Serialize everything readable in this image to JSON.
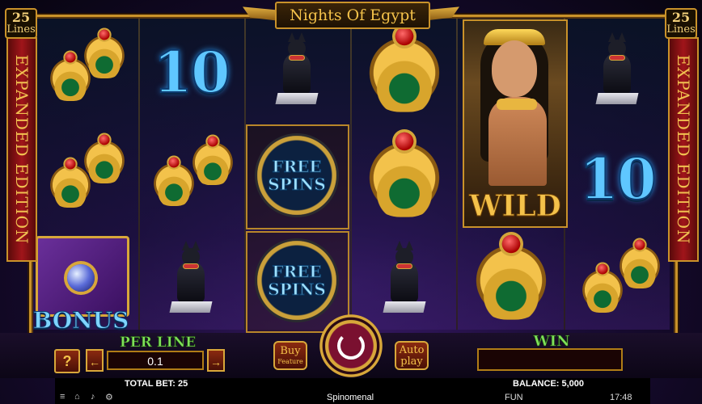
{
  "game": {
    "title": "Nights Of Egypt",
    "lines_badge": {
      "number": "25",
      "word": "Lines"
    },
    "edition_banner": "EXPANDED EDITION"
  },
  "reels": {
    "symbols": [
      [
        "scarab-pair",
        "scarab-pair",
        "bonus-book"
      ],
      [
        "ten",
        "scarab-pair",
        "cat"
      ],
      [
        "cat",
        "free-spins",
        "free-spins"
      ],
      [
        "scarab",
        "scarab",
        "cat"
      ],
      [
        "wild",
        "wild",
        "scarab"
      ],
      [
        "cat",
        "ten",
        "scarab-pair"
      ]
    ],
    "ten_label": "10",
    "free_spins_label_line1": "FREE",
    "free_spins_label_line2": "SPINS",
    "wild_label": "WILD",
    "bonus_label": "BONUS"
  },
  "controls": {
    "help_label": "?",
    "per_line_label": "PER LINE",
    "per_line_value": "0.1",
    "decrease_label": "←",
    "increase_label": "→",
    "buy_label": "Buy",
    "buy_sub": "Feature",
    "auto_label1": "Auto",
    "auto_label2": "play",
    "win_label": "WIN",
    "win_value": ""
  },
  "status": {
    "total_bet": "TOTAL BET: 25",
    "balance": "BALANCE: 5,000"
  },
  "footer": {
    "menu_icon": "≡",
    "home_icon": "⌂",
    "sound_icon": "♪",
    "settings_icon": "⚙",
    "brand": "Spinomenal",
    "mode": "FUN",
    "time": "17:48"
  }
}
